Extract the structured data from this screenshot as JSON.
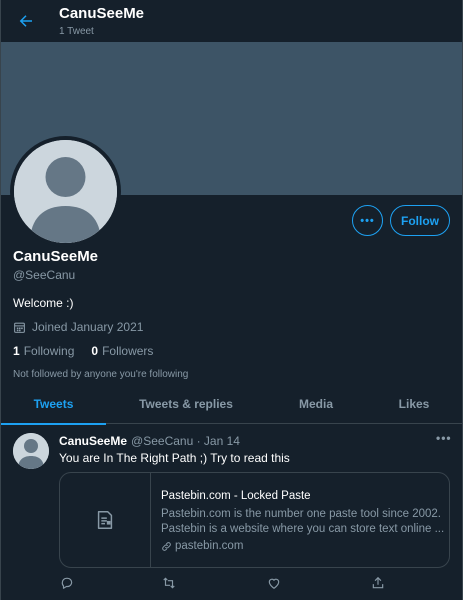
{
  "header": {
    "name": "CanuSeeMe",
    "tweet_count": "1 Tweet"
  },
  "profile": {
    "name": "CanuSeeMe",
    "handle": "@SeeCanu",
    "bio": "Welcome :)",
    "joined": "Joined January 2021",
    "following_count": "1",
    "following_label": "Following",
    "followers_count": "0",
    "followers_label": "Followers",
    "not_followed": "Not followed by anyone you're following",
    "follow_button": "Follow",
    "more_button": "•••"
  },
  "tabs": [
    {
      "label": "Tweets",
      "active": true
    },
    {
      "label": "Tweets & replies",
      "active": false
    },
    {
      "label": "Media",
      "active": false
    },
    {
      "label": "Likes",
      "active": false
    }
  ],
  "tweet": {
    "name": "CanuSeeMe",
    "meta": "@SeeCanu · Jan 14",
    "text": "You are In The Right Path ;) Try to read this",
    "more": "•••",
    "card": {
      "title": "Pastebin.com - Locked Paste",
      "description": "Pastebin.com is the number one paste tool since 2002. Pastebin is a website where you can store text online ...",
      "domain": "pastebin.com"
    }
  },
  "colors": {
    "background": "#15202b",
    "banner": "#3d5466",
    "accent": "#1da1f2",
    "muted": "#8899a6",
    "border": "#38444d"
  },
  "icons": [
    "back-arrow-icon",
    "calendar-icon",
    "document-icon",
    "link-icon",
    "reply-icon",
    "retweet-icon",
    "like-icon",
    "share-icon"
  ]
}
